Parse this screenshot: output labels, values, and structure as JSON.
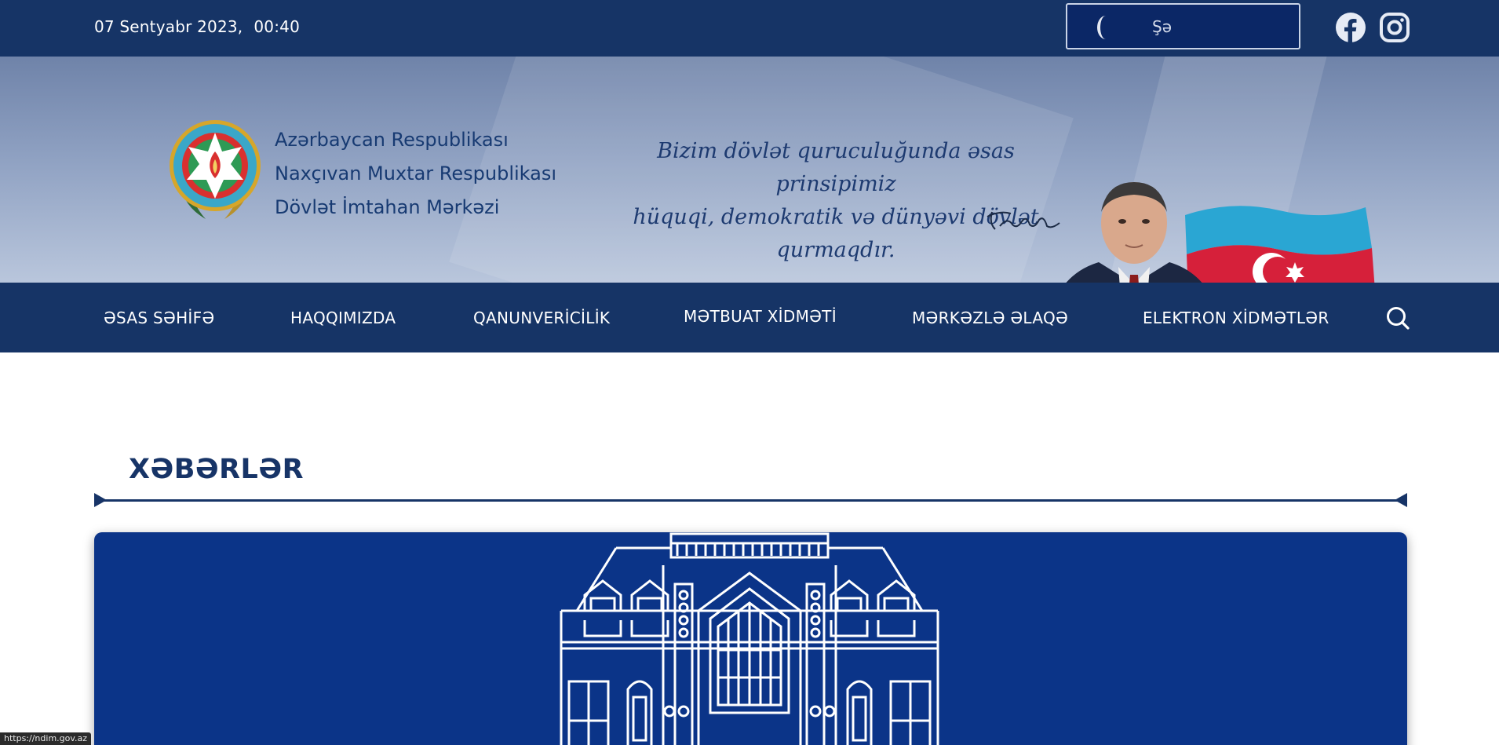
{
  "topbar": {
    "date": "07 Sentyabr 2023,",
    "time": "00:40",
    "language_label": "Şə",
    "social": [
      "facebook-icon",
      "instagram-icon"
    ]
  },
  "banner": {
    "org_lines": [
      "Azərbaycan Respublikası",
      "Naxçıvan Muxtar Respublikası",
      "Dövlət İmtahan Mərkəzi"
    ],
    "quote_line1": "Bizim dövlət quruculuğunda əsas prinsipimiz",
    "quote_line2": "hüquqi, demokratik və dünyəvi dövlət qurmaqdır."
  },
  "nav": {
    "items": [
      "ƏSAS SƏHİFƏ",
      "HAQQIMIZDA",
      "QANUNVERİCİLİK",
      "MƏTBUAT XİDMƏTİ",
      "MƏRKƏZLƏ ƏLAQƏ",
      "ELEKTRON XİDMƏTLƏR"
    ],
    "search_icon": "search-icon"
  },
  "news": {
    "title": "XƏBƏRLƏR"
  },
  "status_bar": {
    "url": "https://ndim.gov.az"
  },
  "colors": {
    "navy": "#163466",
    "card_blue": "#0b3488",
    "heading": "#173467"
  }
}
